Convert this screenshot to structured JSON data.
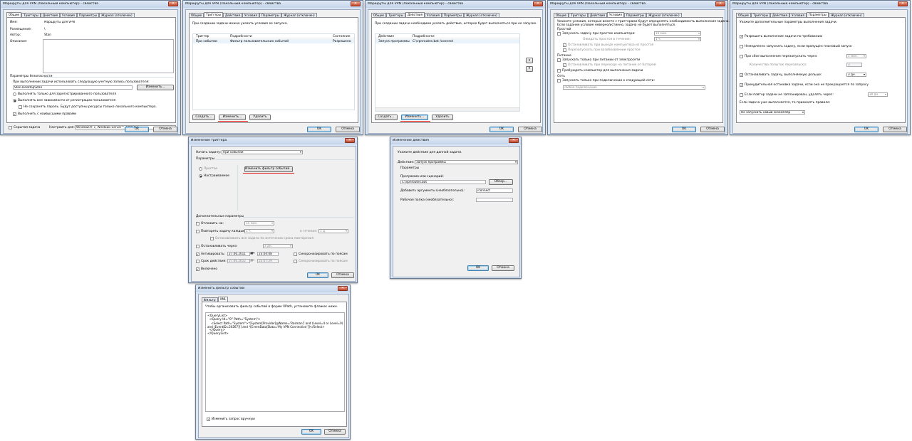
{
  "w1": {
    "title": "Маршруты для VPN (Локальный компьютер) - свойства",
    "tabs": [
      "Общие",
      "Триггеры",
      "Действия",
      "Условия",
      "Параметры",
      "Журнал (отключен)"
    ],
    "name_label": "Имя:",
    "name_value": "Маршруты для VPN",
    "location_label": "Размещение:",
    "location_value": "\\",
    "author_label": "Автор:",
    "author_value": "Stan",
    "desc_label": "Описание:",
    "security_label": "Параметры безопасности",
    "run_as_label": "При выполнении задачи использовать следующую учетную запись пользователя:",
    "run_as_value": "Stan-Desktop\\Stan",
    "change_btn": "Изменить...",
    "opt_logged": "Выполнять только для зарегистрированного пользователя",
    "opt_any": "Выполнять вне зависимости от регистрации пользователя",
    "opt_nopass": "Не сохранять пароль. Будут доступны ресурсы только локального компьютера.",
    "opt_highest": "Выполнить с наивысшими правами",
    "hidden_label": "Скрытая задача",
    "config_label": "Настроить для:",
    "config_value": "Windows® 7, Windows Server™ 2008 R2",
    "ok": "OK",
    "cancel": "Отмена"
  },
  "w2": {
    "title": "Маршруты для VPN (Локальный компьютер) - свойства",
    "intro": "При создании задачи можно указать условия ее запуска.",
    "columns": [
      "Триггер",
      "Подробности",
      "Состояние"
    ],
    "rows": [
      {
        "c1": "При событии",
        "c2": "Фильтр пользовательских событий",
        "c3": "Разрешено"
      }
    ],
    "create": "Создать...",
    "change": "Изменить...",
    "delete": "Удалить",
    "ok": "OK",
    "cancel": "Отмена"
  },
  "w3": {
    "title": "Маршруты для VPN (Локальный компьютер) - свойства",
    "intro": "При создании задачи необходимо указать действие, которое будет выполняться при ее запуске.",
    "columns": [
      "Действие",
      "Подробности"
    ],
    "rows": [
      {
        "c1": "Запуск программы",
        "c2": "C:\\vpnroutes.bat /connect"
      }
    ],
    "create": "Создать...",
    "change": "Изменить...",
    "delete": "Удалить",
    "ok": "OK",
    "cancel": "Отмена"
  },
  "w4": {
    "title": "Маршруты для VPN (Локальный компьютер) - свойства",
    "intro1": "Укажите условия, которые вместе с триггерами будут определять необходимость выполнения задачи.",
    "intro2": "Если задание условие неверно/истинно, задача не будет выполняться.",
    "idle_group": "Простой",
    "idle_start": "Запускать задачу при простое компьютера:",
    "idle_start_val": "10 мин.",
    "idle_wait": "Ожидать простоя в течение:",
    "idle_wait_val": "1 ч.",
    "idle_stop": "Останавливать при выходе компьютера из простоя",
    "idle_restart": "Перезапускать при возобновлении простоя",
    "power_group": "Питание",
    "power_ac": "Запускать только при питании от электросети",
    "power_batt": "Останавливать при переходе на питание от батарей",
    "power_wake": "Пробуждать компьютер для выполнения задачи",
    "net_group": "Сеть",
    "net_only": "Запускать только при подключении к следующей сети:",
    "net_value": "Любое подключение",
    "ok": "OK",
    "cancel": "Отмена"
  },
  "w5": {
    "title": "Маршруты для VPN (Локальный компьютер) - свойства",
    "intro": "Укажите дополнительные параметры выполнения задачи.",
    "o1": "Разрешить выполнение задачи по требованию",
    "o2": "Немедленно запускать задачу, если пропущен плановый запуск",
    "o3": "При сбое выполнения перезапускать через:",
    "o3_val": "1 мин.",
    "o3b": "Количество попыток перезапуска:",
    "o3b_val": "3",
    "o4": "Останавливать задачу, выполняемую дольше:",
    "o4_val": "3 дн.",
    "o5": "Принудительная остановка задачи, если она не прекращается по запросу",
    "o6": "Если повтор задачи не запланирован, удалять через:",
    "o6_val": "30 дн.",
    "o7": "Если задача уже выполняется, то применять правило:",
    "o7_val": "Не запускать новый экземпляр",
    "ok": "OK",
    "cancel": "Отмена"
  },
  "w6": {
    "title": "Изменение триггера",
    "begin_label": "Начать задачу:",
    "begin_value": "При событии",
    "params": "Параметры",
    "r_simple": "Простое",
    "r_custom": "Настраиваемое",
    "filter_btn": "Изменить фильтр событий...",
    "adv": "Дополнительные параметры",
    "delay": "Отложить на:",
    "delay_val": "15 мин.",
    "repeat": "Повторять задачу каждые:",
    "repeat_val": "1 ч.",
    "duration_label": "в течение:",
    "duration_val": "1 д.",
    "stop_all": "Останавливать все задачи по истечении срока повторения",
    "stop_after": "Останавливать через:",
    "stop_after_val": "3 дн.",
    "activate": "Активировать:",
    "act_date": "27.06.2011",
    "act_time": "23:04:08",
    "expire": "Срок действия:",
    "exp_date": "27.06.2012",
    "exp_time": "23:07:29",
    "sync1": "Синхронизировать по поясам",
    "sync2": "Синхронизировать по поясам",
    "enabled": "Включено",
    "ok": "OK",
    "cancel": "Отмена"
  },
  "w7": {
    "title": "Изменение действия",
    "intro": "Укажите действие для данной задачи.",
    "action_label": "Действие:",
    "action_value": "Запуск программы",
    "params": "Параметры",
    "prog_label": "Программа или сценарий:",
    "prog_value": "C:\\vpnroutes.bat",
    "browse": "Обзор...",
    "args_label": "Добавить аргументы (необязательно):",
    "args_value": "/connect",
    "start_label": "Рабочая папка (необязательно):",
    "ok": "OK",
    "cancel": "Отмена"
  },
  "w8": {
    "title": "Изменить фильтр событий",
    "tabs": [
      "Фильтр",
      "XML"
    ],
    "intro": "Чтобы организовать фильтр событий в форме XPath, установите флажок ниже.",
    "xml": [
      "<QueryList>",
      "  <Query Id=\"0\" Path=\"System\">",
      "    <Select Path=\"System\">*[System[Provider[@Name='Rasman'] and (Level=4 or Level=0)",
      "and (EventID=20267)]] and *[EventData[Data='My VPN Connection']]</Select>",
      "  </Query>",
      "</QueryList>"
    ],
    "manual": "Изменить запрос вручную",
    "ok": "OK",
    "cancel": "Отмена"
  }
}
